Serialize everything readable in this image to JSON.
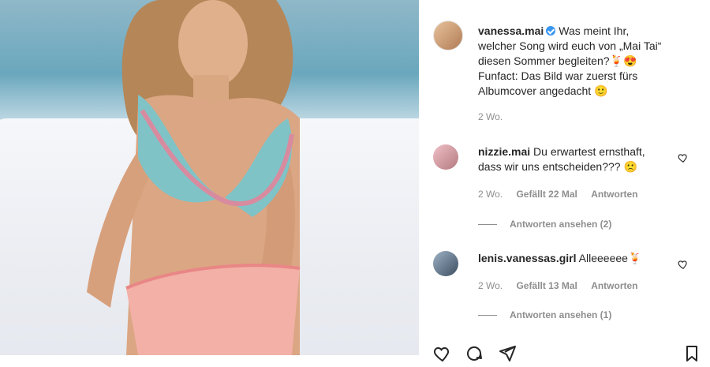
{
  "post": {
    "username": "vanessa.mai",
    "verified": true,
    "caption_line1": "Was meint Ihr,",
    "caption_line2": "welcher Song wird euch von „Mai Tai“",
    "caption_line3": "diesen Sommer begleiten?",
    "caption_emojis": "🍹😍",
    "caption_line4": "Funfact: Das Bild war zuerst fürs",
    "caption_line5": "Albumcover angedacht",
    "caption_emoji_end": "🙂",
    "time": "2 Wo."
  },
  "comments": [
    {
      "username": "nizzie.mai",
      "text_line1": "Du erwartest ernsthaft,",
      "text_line2": "dass wir uns entscheiden???",
      "emoji": "🙁",
      "time": "2 Wo.",
      "likes": "Gefällt 22 Mal",
      "reply": "Antworten",
      "view_replies": "Antworten ansehen (2)"
    },
    {
      "username": "lenis.vanessas.girl",
      "text": "Alleeeeee",
      "emoji": "🍹",
      "time": "2 Wo.",
      "likes": "Gefällt 13 Mal",
      "reply": "Antworten",
      "view_replies": "Antworten ansehen (1)"
    }
  ],
  "icons": {
    "like": "heart-icon",
    "comment": "comment-icon",
    "share": "share-icon",
    "save": "bookmark-icon"
  },
  "colors": {
    "text": "#262626",
    "secondary": "#8e8e8e",
    "verified": "#3897f0"
  }
}
